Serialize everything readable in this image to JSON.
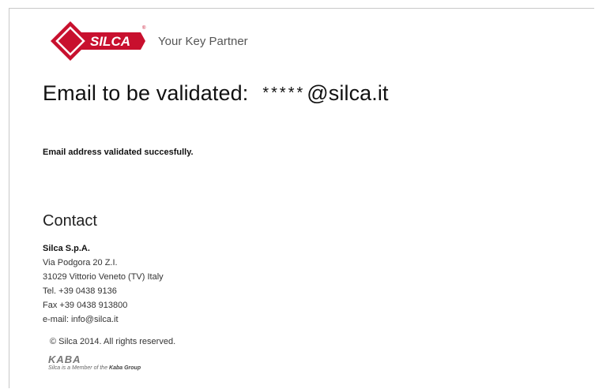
{
  "brand": {
    "logo_text": "SILCA",
    "logo_color": "#c8102e",
    "tagline": "Your Key Partner"
  },
  "validation": {
    "heading_label": "Email to be validated:",
    "masked_local": "*****",
    "domain": "@silca.it",
    "status_message": "Email address validated succesfully."
  },
  "contact": {
    "heading": "Contact",
    "company": "Silca S.p.A.",
    "address_line1": "Via Podgora 20 Z.I.",
    "address_line2": "31029 Vittorio Veneto (TV) Italy",
    "tel": "Tel. +39 0438 9136",
    "fax": "Fax +39 0438 913800",
    "email": "e-mail: info@silca.it"
  },
  "footer": {
    "copyright": "© Silca 2014. All rights reserved.",
    "kaba_logo": "KABA",
    "kaba_member_prefix": "Silca is a Member of the ",
    "kaba_member_group": "Kaba Group"
  }
}
